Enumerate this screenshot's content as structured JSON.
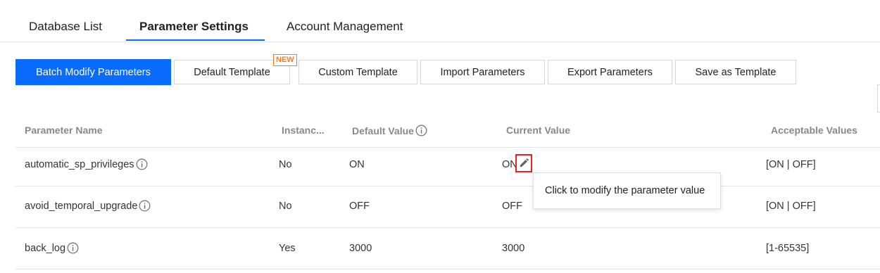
{
  "tabs": [
    {
      "label": "Database List",
      "active": false
    },
    {
      "label": "Parameter Settings",
      "active": true
    },
    {
      "label": "Account Management",
      "active": false
    }
  ],
  "toolbar": {
    "batch_modify": "Batch Modify Parameters",
    "default_template": "Default Template",
    "new_badge": "NEW",
    "custom_template": "Custom Template",
    "import_parameters": "Import Parameters",
    "export_parameters": "Export Parameters",
    "save_as_template": "Save as Template"
  },
  "table": {
    "headers": {
      "name": "Parameter Name",
      "instance": "Instanc...",
      "default": "Default Value",
      "current": "Current Value",
      "acceptable": "Acceptable Values"
    },
    "rows": [
      {
        "name": "automatic_sp_privileges",
        "instance": "No",
        "default": "ON",
        "current": "ON",
        "acceptable": "[ON | OFF]"
      },
      {
        "name": "avoid_temporal_upgrade",
        "instance": "No",
        "default": "OFF",
        "current": "OFF",
        "acceptable": "[ON | OFF]"
      },
      {
        "name": "back_log",
        "instance": "Yes",
        "default": "3000",
        "current": "3000",
        "acceptable": "[1-65535]"
      }
    ]
  },
  "tooltip": {
    "text": "Click to modify the parameter value"
  },
  "icons": {
    "info": "info-icon",
    "edit": "pencil-icon"
  },
  "colors": {
    "primary": "#0a6cff",
    "badge": "#ff7a1a",
    "highlight": "#e8202a"
  }
}
